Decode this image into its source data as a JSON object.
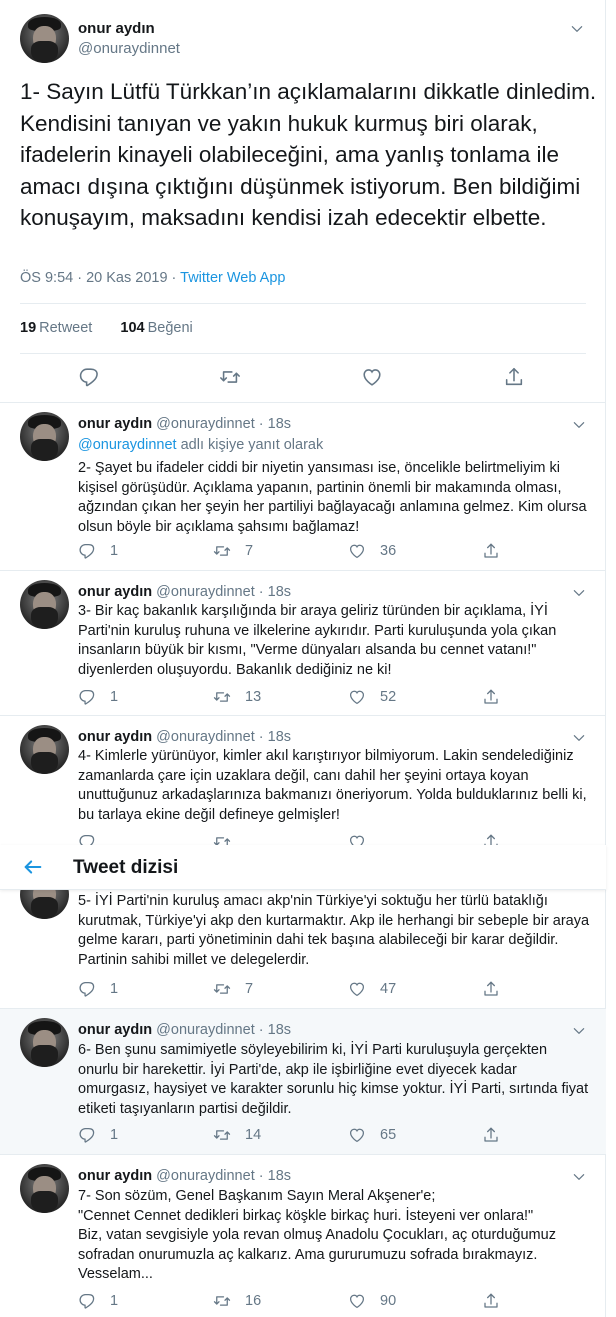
{
  "colors": {
    "accent": "#1b95e0",
    "secondary_text": "#657786",
    "border": "#e6ecf0"
  },
  "main_tweet": {
    "author_name": "onur aydın",
    "author_handle": "@onuraydinnet",
    "text": "1- Sayın Lütfü Türkkan’ın açıklamalarını dikkatle dinledim. Kendisini tanıyan ve yakın hukuk kurmuş biri olarak, ifadelerin kinayeli olabileceğini, ama yanlış tonlama ile amacı dışına çıktığını düşünmek istiyorum. Ben bildiğimi konuşayım, maksadını kendisi izah edecektir elbette.",
    "time": "ÖS 9:54 · 20 Kas 2019 · ",
    "source": "Twitter Web App",
    "retweet_count": "19",
    "retweet_label": "Retweet",
    "like_count": "104",
    "like_label": "Beğeni",
    "icons": [
      "reply-icon",
      "retweet-icon",
      "like-icon",
      "share-icon",
      "chevron-down-icon"
    ]
  },
  "thread_header": {
    "title": "Tweet dizisi",
    "back_icon": "back-arrow-icon"
  },
  "replies": [
    {
      "name": "onur aydın",
      "handle": "@onuraydinnet",
      "dot": "·",
      "time": "18s",
      "reply_to_link": "@onuraydinnet",
      "reply_to_suffix": " adlı kişiye yanıt olarak",
      "text": "2- Şayet bu ifadeler ciddi bir niyetin yansıması ise, öncelikle belirtmeliyim ki kişisel görüşüdür. Açıklama yapanın, partinin önemli bir makamında olması, ağzından çıkan her şeyin her partiliyi bağlayacağı anlamına gelmez. Kim olursa olsun böyle bir açıklama şahsımı bağlamaz!",
      "replies": "1",
      "retweets": "7",
      "likes": "36"
    },
    {
      "name": "onur aydın",
      "handle": "@onuraydinnet",
      "dot": "·",
      "time": "18s",
      "text": "3- Bir kaç bakanlık karşılığında bir araya geliriz türünden bir açıklama, İYİ Parti'nin kuruluş ruhuna ve ilkelerine aykırıdır. Parti kuruluşunda yola çıkan insanların büyük bir kısmı, \"Verme dünyaları alsanda bu cennet vatanı!\" diyenlerden oluşuyordu. Bakanlık dediğiniz ne ki!",
      "replies": "1",
      "retweets": "13",
      "likes": "52"
    },
    {
      "name": "onur aydın",
      "handle": "@onuraydinnet",
      "dot": "·",
      "time": "18s",
      "text": "4- Kimlerle yürünüyor, kimler akıl karıştırıyor bilmiyorum. Lakin sendelediğiniz zamanlarda çare için uzaklara değil, canı dahil her şeyini ortaya koyan unuttuğunuz arkadaşlarınıza bakmanızı öneriyorum. Yolda bulduklarınız belli ki, bu tarlaya ekine değil defineye gelmişler!",
      "replies": "",
      "retweets": "",
      "likes": ""
    },
    {
      "text": "5- İYİ Parti'nin kuruluş amacı akp'nin Türkiye'yi soktuğu her türlü bataklığı kurutmak, Türkiye'yi akp den kurtarmaktır. Akp ile herhangi bir sebeple bir araya gelme kararı, parti yönetiminin dahi tek başına alabileceği bir karar değildir. Partinin sahibi millet ve delegelerdir.",
      "replies": "1",
      "retweets": "7",
      "likes": "47"
    },
    {
      "name": "onur aydın",
      "handle": "@onuraydinnet",
      "dot": "·",
      "time": "18s",
      "text": "6- Ben şunu samimiyetle söyleyebilirim ki, İYİ Parti kuruluşuyla gerçekten onurlu bir harekettir. İyi Parti'de, akp ile işbirliğine evet diyecek kadar omurgasız, haysiyet ve karakter sorunlu hiç kimse yoktur. İYİ Parti, sırtında fiyat etiketi taşıyanların partisi değildir.",
      "replies": "1",
      "retweets": "14",
      "likes": "65"
    },
    {
      "name": "onur aydın",
      "handle": "@onuraydinnet",
      "dot": "·",
      "time": "18s",
      "text": "7- Son sözüm, Genel Başkanım Sayın Meral Akşener'e;\n\"Cennet Cennet dedikleri birkaç köşkle birkaç huri. İsteyeni ver onlara!\"\nBiz, vatan sevgisiyle yola revan olmuş Anadolu Çocukları, aç oturduğumuz sofradan onurumuzla aç kalkarız. Ama gururumuzu sofrada bırakmayız. Vesselam...",
      "replies": "1",
      "retweets": "16",
      "likes": "90"
    }
  ]
}
